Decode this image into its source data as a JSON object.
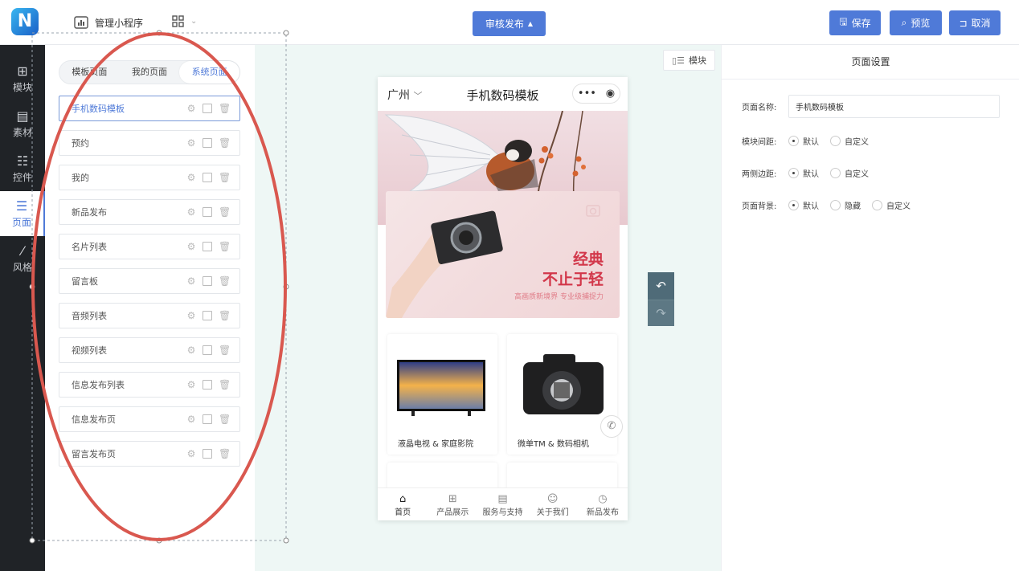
{
  "header": {
    "app_name": "管理小程序",
    "center_button": "审核发布",
    "save": "保存",
    "preview": "预览",
    "cancel": "取消"
  },
  "sidebar": {
    "items": [
      {
        "label": "模块",
        "icon": "plus-square-icon"
      },
      {
        "label": "素材",
        "icon": "material-icon"
      },
      {
        "label": "控件",
        "icon": "control-icon"
      },
      {
        "label": "页面",
        "icon": "page-icon",
        "active": true
      },
      {
        "label": "风格",
        "icon": "magic-wand-icon"
      }
    ]
  },
  "panel": {
    "tabs": [
      "模板页面",
      "我的页面",
      "系统页面"
    ],
    "active_tab": "系统页面",
    "pages": [
      "手机数码模板",
      "预约",
      "我的",
      "新品发布",
      "名片列表",
      "留言板",
      "音频列表",
      "视频列表",
      "信息发布列表",
      "信息发布页",
      "留言发布页"
    ],
    "selected_page": "手机数码模板"
  },
  "canvas": {
    "module_button": "模块",
    "phone": {
      "city": "广州",
      "title": "手机数码模板",
      "slogan_line1": "经典",
      "slogan_line2": "不止于轻",
      "slogan_sub": "高画质新境界 专业级捕捉力",
      "products": [
        "液晶电视 & 家庭影院",
        "微单TM & 数码相机"
      ],
      "tabbar": [
        "首页",
        "产品展示",
        "服务与支持",
        "关于我们",
        "新品发布"
      ]
    }
  },
  "settings": {
    "title": "页面设置",
    "name_label": "页面名称:",
    "name_value": "手机数码模板",
    "spacing_label": "模块间距:",
    "margin_label": "两侧边距:",
    "background_label": "页面背景:",
    "opt_default": "默认",
    "opt_custom": "自定义",
    "opt_hide": "隐藏"
  },
  "colors": {
    "accent": "#4f7ad8",
    "sidebar_bg": "#202327",
    "canvas_bg": "#eef7f5",
    "annotation": "#d9584f"
  }
}
